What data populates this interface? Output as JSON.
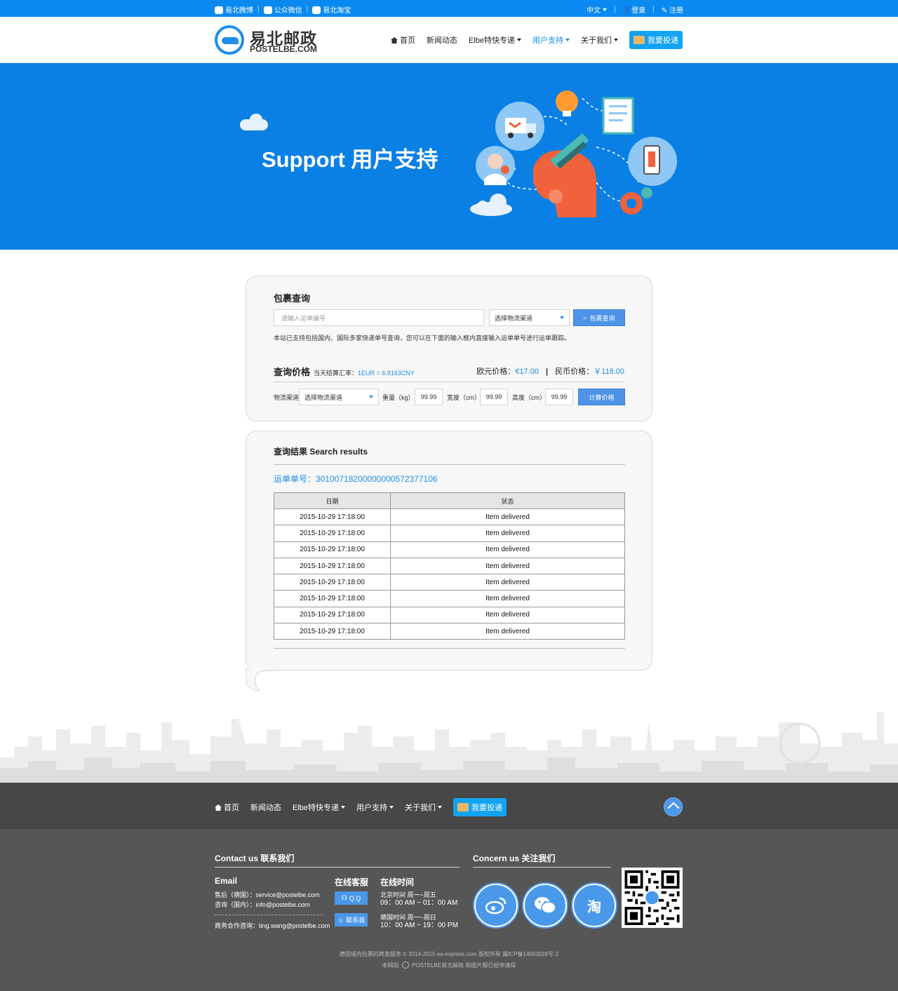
{
  "topbar": {
    "weibo": "易北微博",
    "wechat": "公众微信",
    "taobao": "易北淘宝",
    "lang": "中文",
    "login": "登录",
    "register": "注册"
  },
  "header": {
    "logo_cn": "易北邮政",
    "logo_en": "POSTELBE.COM",
    "nav": {
      "home": "首页",
      "news": "新闻动态",
      "express": "Elbe特快专递",
      "support": "用户支持",
      "about": "关于我们",
      "deliver": "我要投递"
    }
  },
  "banner": {
    "title": "Support 用户支持"
  },
  "query": {
    "title": "包裹查询",
    "input_placeholder": "请输入运单编号",
    "channel_select": "选择物流渠道",
    "search_btn": "包裹查询",
    "note": "本站已支持包括国内、国际多家快递单号查询，您可以在下面的输入框内直接输入运单单号进行运单跟踪。"
  },
  "price": {
    "title": "查询价格",
    "rate_label": "当天结算汇率：",
    "rate_value": "1EUR = 6.9163CNY",
    "eur_label": "欧元价格：",
    "eur_value": "€17.00",
    "divider": "|",
    "cny_label": "民币价格：",
    "cny_value": "￥118.00",
    "channel_label": "物流渠道",
    "channel_select": "选择物流渠道",
    "weight_label": "重量（kg）",
    "weight_value": "99.99",
    "width_label": "宽度（cm）",
    "width_value": "99.99",
    "height_label": "高度（cm）",
    "height_value": "99.99",
    "calc_btn": "计算价格"
  },
  "results": {
    "title": "查询结果 Search results",
    "tracking_label": "运单单号：",
    "tracking_number": "30100718200000000572377106",
    "columns": [
      "日期",
      "状态"
    ],
    "rows": [
      [
        "2015-10-29 17:18:00",
        "Item delivered"
      ],
      [
        "2015-10-29 17:18:00",
        "Item delivered"
      ],
      [
        "2015-10-29 17:18:00",
        "Item delivered"
      ],
      [
        "2015-10-29 17:18:00",
        "Item delivered"
      ],
      [
        "2015-10-29 17:18:00",
        "Item delivered"
      ],
      [
        "2015-10-29 17:18:00",
        "Item delivered"
      ],
      [
        "2015-10-29 17:18:00",
        "Item delivered"
      ],
      [
        "2015-10-29 17:18:00",
        "Item delivered"
      ]
    ]
  },
  "footer_nav": {
    "home": "首页",
    "news": "新闻动态",
    "express": "Elbe特快专递",
    "support": "用户支持",
    "about": "关于我们",
    "deliver": "我要投递"
  },
  "footer": {
    "contact_title": "Contact us 联系我们",
    "email_title": "Email",
    "aftersale": "售后（德国）：service@postelbe.com",
    "consult": "咨询（国内）：info@postelbe.com",
    "business": "商务合作咨询：ting.wang@postelbe.com",
    "online_service_title": "在线客服",
    "qq_btn": "Q Q",
    "contact_btn": "联系我",
    "online_time_title": "在线时间",
    "beijing_label": "北京时间 周一~周五",
    "beijing_time": "09：00 AM ~ 01：00 AM",
    "germany_label": "德国时间 周一~周日",
    "germany_time": "10：00 AM ~ 19：00 PM",
    "concern_title": "Concern us 关注我们",
    "taobao_char": "淘",
    "copyright": "德国境内包裹的转发服务 © 2014-2015 ea-express.com 版权所有 闽ICP备14003028号-2",
    "notice_pre": "本网站",
    "notice_brand": "POSTELBE易北邮政",
    "notice_post": "和图片都已经申请保"
  },
  "colors": {
    "brand_blue": "#0a8af0",
    "banner_blue": "#0a80e4",
    "button_blue": "#4d94e8",
    "footer_dark": "#474747",
    "footer_gray": "#575656"
  }
}
